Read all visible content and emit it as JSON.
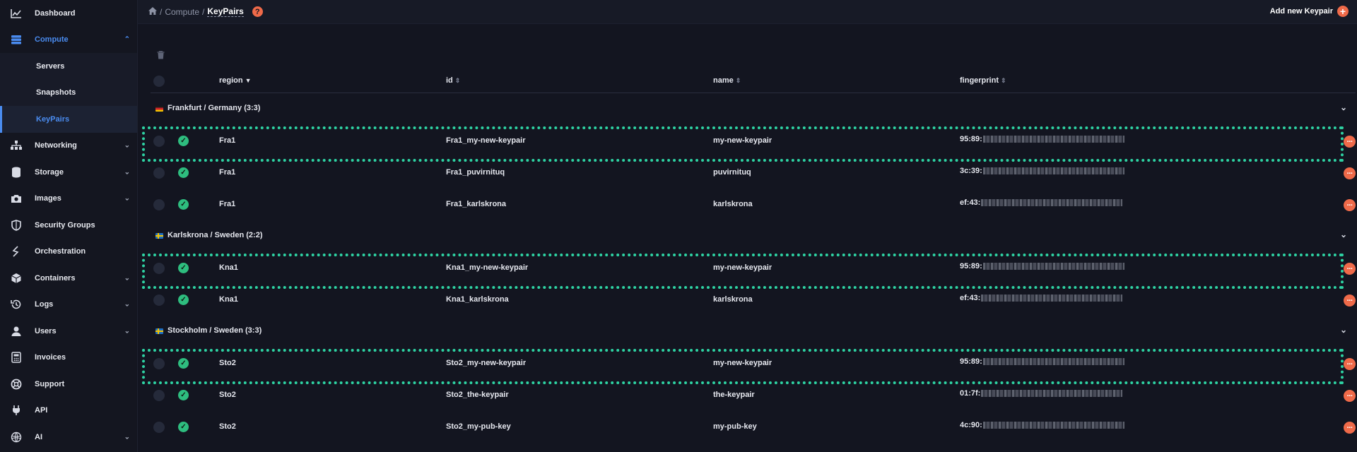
{
  "sidebar": {
    "items": [
      {
        "label": "Dashboard",
        "icon": "chart-icon"
      },
      {
        "label": "Compute",
        "icon": "server-icon",
        "expanded": true
      },
      {
        "label": "Servers"
      },
      {
        "label": "Snapshots"
      },
      {
        "label": "KeyPairs"
      },
      {
        "label": "Networking",
        "icon": "network-icon"
      },
      {
        "label": "Storage",
        "icon": "database-icon"
      },
      {
        "label": "Images",
        "icon": "camera-icon"
      },
      {
        "label": "Security Groups",
        "icon": "shield-icon"
      },
      {
        "label": "Orchestration",
        "icon": "orchestration-icon"
      },
      {
        "label": "Containers",
        "icon": "cube-icon"
      },
      {
        "label": "Logs",
        "icon": "history-icon"
      },
      {
        "label": "Users",
        "icon": "user-icon"
      },
      {
        "label": "Invoices",
        "icon": "calculator-icon"
      },
      {
        "label": "Support",
        "icon": "lifebuoy-icon"
      },
      {
        "label": "API",
        "icon": "plug-icon"
      },
      {
        "label": "AI",
        "icon": "ai-icon"
      }
    ]
  },
  "header": {
    "breadcrumb": [
      "Compute",
      "KeyPairs"
    ],
    "help": "?",
    "add_label": "Add new Keypair",
    "add_icon": "+"
  },
  "table": {
    "columns": [
      "region",
      "id",
      "name",
      "fingerprint"
    ],
    "groups": [
      {
        "label": "Frankfurt / Germany (3:3)",
        "rows": [
          {
            "region": "Fra1",
            "id": "Fra1_my-new-keypair",
            "name": "my-new-keypair",
            "fingerprint": "95:89:"
          },
          {
            "region": "Fra1",
            "id": "Fra1_puvirnituq",
            "name": "puvirnituq",
            "fingerprint": "3c:39:"
          },
          {
            "region": "Fra1",
            "id": "Fra1_karlskrona",
            "name": "karlskrona",
            "fingerprint": "ef:43:"
          }
        ]
      },
      {
        "label": "Karlskrona / Sweden (2:2)",
        "rows": [
          {
            "region": "Kna1",
            "id": "Kna1_my-new-keypair",
            "name": "my-new-keypair",
            "fingerprint": "95:89:"
          },
          {
            "region": "Kna1",
            "id": "Kna1_karlskrona",
            "name": "karlskrona",
            "fingerprint": "ef:43:"
          }
        ]
      },
      {
        "label": "Stockholm / Sweden (3:3)",
        "rows": [
          {
            "region": "Sto2",
            "id": "Sto2_my-new-keypair",
            "name": "my-new-keypair",
            "fingerprint": "95:89:"
          },
          {
            "region": "Sto2",
            "id": "Sto2_the-keypair",
            "name": "the-keypair",
            "fingerprint": "01:7f:"
          },
          {
            "region": "Sto2",
            "id": "Sto2_my-pub-key",
            "name": "my-pub-key",
            "fingerprint": "4c:90:"
          }
        ]
      }
    ]
  },
  "colors": {
    "accent": "#4a8cf0",
    "action": "#ef6a49",
    "status_ok": "#2ebd7f",
    "highlight": "#2ed3a3"
  }
}
